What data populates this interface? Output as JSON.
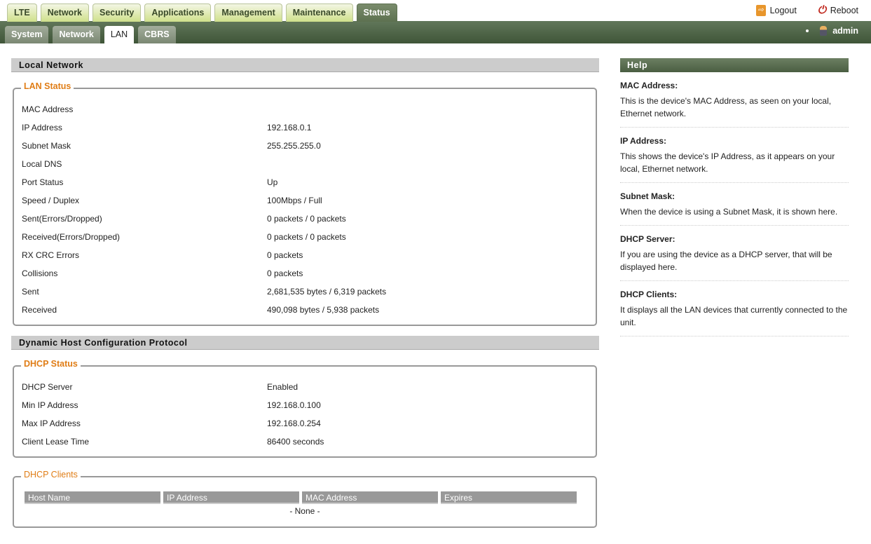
{
  "main_tabs": [
    "LTE",
    "Network",
    "Security",
    "Applications",
    "Management",
    "Maintenance",
    "Status"
  ],
  "sub_tabs": [
    "System",
    "Network",
    "LAN",
    "CBRS"
  ],
  "top_links": {
    "logout": "Logout",
    "reboot": "Reboot",
    "user": "admin"
  },
  "local_network": {
    "title": "Local Network",
    "legend": "LAN Status",
    "rows": [
      [
        "MAC Address",
        ""
      ],
      [
        "IP Address",
        "192.168.0.1"
      ],
      [
        "Subnet Mask",
        "255.255.255.0"
      ],
      [
        "Local DNS",
        ""
      ],
      [
        "Port Status",
        "Up"
      ],
      [
        "Speed / Duplex",
        "100Mbps / Full"
      ],
      [
        "Sent(Errors/Dropped)",
        "0 packets / 0 packets"
      ],
      [
        "Received(Errors/Dropped)",
        "0 packets / 0 packets"
      ],
      [
        "RX CRC Errors",
        "0 packets"
      ],
      [
        "Collisions",
        "0 packets"
      ],
      [
        "Sent",
        "2,681,535 bytes / 6,319 packets"
      ],
      [
        "Received",
        "490,098 bytes / 5,938 packets"
      ]
    ]
  },
  "dhcp": {
    "title": "Dynamic Host Configuration Protocol",
    "legend": "DHCP Status",
    "rows": [
      [
        "DHCP Server",
        "Enabled"
      ],
      [
        "Min IP Address",
        "192.168.0.100"
      ],
      [
        "Max IP Address",
        "192.168.0.254"
      ],
      [
        "Client Lease Time",
        "86400 seconds"
      ]
    ]
  },
  "clients": {
    "legend": "DHCP Clients",
    "headers": [
      "Host Name",
      "IP Address",
      "MAC Address",
      "Expires"
    ],
    "empty": "- None -"
  },
  "help": {
    "title": "Help",
    "items": [
      {
        "h": "MAC Address:",
        "p": "This is the device's MAC Address, as seen on your local, Ethernet network."
      },
      {
        "h": "IP Address:",
        "p": "This shows the device's IP Address, as it appears on your local, Ethernet network."
      },
      {
        "h": "Subnet Mask:",
        "p": "When the device is using a Subnet Mask, it is shown here."
      },
      {
        "h": "DHCP Server:",
        "p": "If you are using the device as a DHCP server, that will be displayed here."
      },
      {
        "h": "DHCP Clients:",
        "p": "It displays all the LAN devices that currently connected to the unit."
      }
    ]
  }
}
